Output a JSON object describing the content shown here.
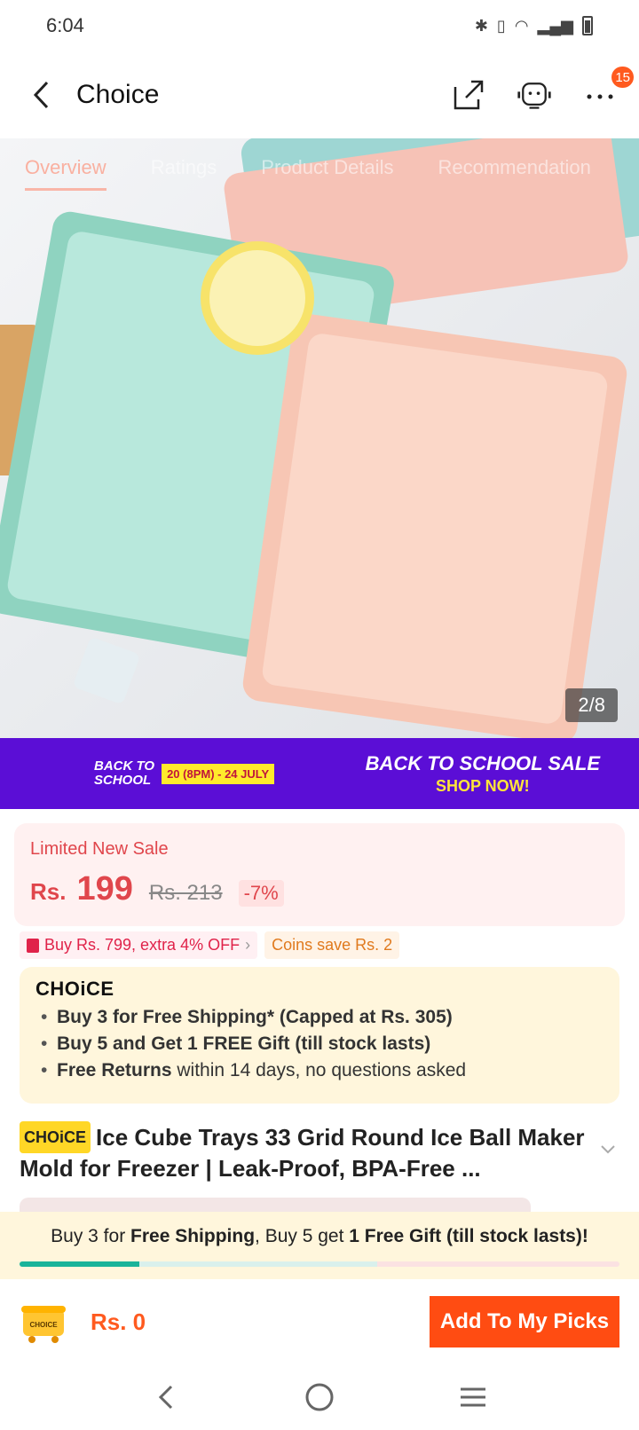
{
  "status_bar": {
    "time": "6:04"
  },
  "header": {
    "title": "Choice",
    "cart_badge": "15"
  },
  "gallery": {
    "tabs": [
      "Overview",
      "Ratings",
      "Product Details",
      "Recommendation"
    ],
    "counter": "2/8"
  },
  "promo": {
    "logo_line1": "BACK TO",
    "logo_line2": "SCHOOL",
    "date": "20 (8PM) - 24 JULY",
    "cta_line1": "BACK TO SCHOOL SALE",
    "cta_line2": "SHOP NOW!"
  },
  "price": {
    "label": "Limited New Sale",
    "currency": "Rs.",
    "current": "199",
    "original": "Rs. 213",
    "discount": "-7%"
  },
  "coupons": {
    "extra_off": "Buy Rs. 799, extra 4% OFF",
    "coins": "Coins save Rs. 2"
  },
  "choice": {
    "logo": "CHOiCE",
    "benefit1": "Buy 3 for  Free Shipping* (Capped at Rs. 305)",
    "benefit2": "Buy 5 and Get 1 FREE Gift (till stock lasts)",
    "benefit3_bold": "Free Returns",
    "benefit3_rest": " within 14 days, no questions asked"
  },
  "product": {
    "tag": "CHOiCE",
    "title": "Ice Cube Trays 33 Grid Round Ice Ball Maker Mold for Freezer | Leak-Proof, BPA-Free ..."
  },
  "shipping": {
    "t1": "Buy 3 for ",
    "t2": "Free Shipping",
    "t3": ", Buy 5 get ",
    "t4": "1 Free Gift (till stock lasts)!",
    "progress": 0.2
  },
  "action": {
    "cart_label": "CHOICE",
    "total": "Rs. 0",
    "add_label": "Add To My Picks"
  },
  "colors": {
    "accent": "#ff4c12",
    "price_red": "#e0464c",
    "promo_purple": "#5b0ed6",
    "choice_yellow": "#ffd726",
    "progress_teal": "#19b49a"
  }
}
